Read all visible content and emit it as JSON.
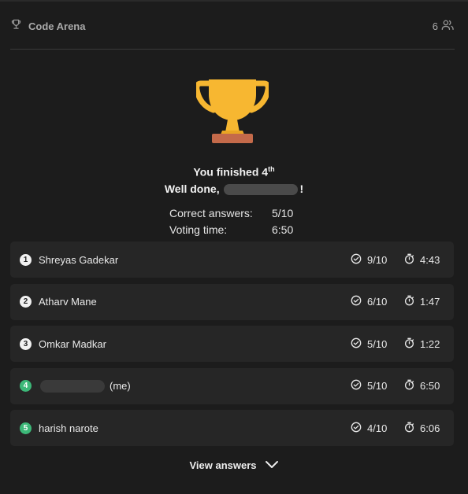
{
  "header": {
    "title": "Code Arena",
    "participants": "6"
  },
  "result": {
    "finished_prefix": "You finished ",
    "place": "4",
    "place_suffix": "th",
    "well_done_prefix": "Well done,",
    "well_done_suffix": "!"
  },
  "stats": [
    {
      "label": "Correct answers:",
      "value": "5/10"
    },
    {
      "label": "Voting time:",
      "value": "6:50"
    }
  ],
  "leaderboard": [
    {
      "rank": "1",
      "name": "Shreyas Gadekar",
      "correct": "9/10",
      "time": "4:43",
      "me": false
    },
    {
      "rank": "2",
      "name": "Atharv Mane",
      "correct": "6/10",
      "time": "1:47",
      "me": false
    },
    {
      "rank": "3",
      "name": "Omkar Madkar",
      "correct": "5/10",
      "time": "1:22",
      "me": false
    },
    {
      "rank": "4",
      "name": "",
      "me_label": "(me)",
      "correct": "5/10",
      "time": "6:50",
      "me": true
    },
    {
      "rank": "5",
      "name": "harish narote",
      "correct": "4/10",
      "time": "6:06",
      "me": false
    }
  ],
  "footer": {
    "view_answers": "View answers"
  },
  "colors": {
    "trophy_gold": "#f7b731",
    "trophy_base": "#c46a4a",
    "me_badge": "#3cb878"
  },
  "icons": {
    "header": "trophy-outline-icon",
    "participants": "users-icon",
    "correct": "check-circle-icon",
    "time": "stopwatch-icon",
    "expand": "chevron-down-icon"
  }
}
